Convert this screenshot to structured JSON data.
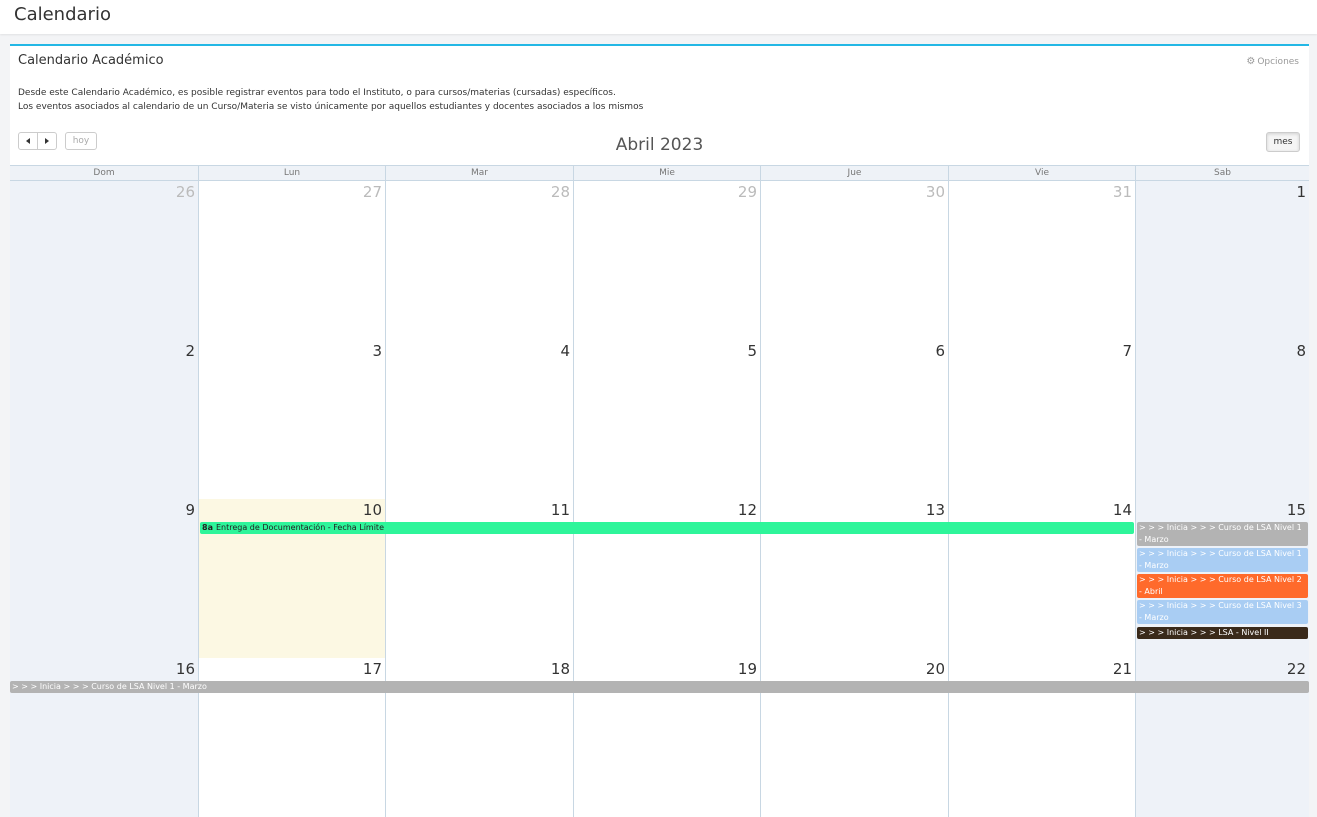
{
  "header": {
    "title": "Calendario"
  },
  "panel": {
    "title": "Calendario Académico",
    "options_label": "Opciones",
    "desc_line1": "Desde este Calendario Académico, es posible registrar eventos para todo el Instituto, o para cursos/materias (cursadas) específicos.",
    "desc_line2": "Los eventos asociados al calendario de un Curso/Materia se visto únicamente por aquellos estudiantes y docentes asociados a los mismos"
  },
  "toolbar": {
    "prev_icon": "triangle-left-icon",
    "next_icon": "triangle-right-icon",
    "today_label": "hoy",
    "month_button_label": "mes",
    "month_title": "Abril 2023"
  },
  "calendar": {
    "weekdays": [
      "Dom",
      "Lun",
      "Mar",
      "Mie",
      "Jue",
      "Vie",
      "Sab"
    ],
    "weeks": [
      [
        "26",
        "27",
        "28",
        "29",
        "30",
        "31",
        "1"
      ],
      [
        "2",
        "3",
        "4",
        "5",
        "6",
        "7",
        "8"
      ],
      [
        "9",
        "10",
        "11",
        "12",
        "13",
        "14",
        "15"
      ],
      [
        "16",
        "17",
        "18",
        "19",
        "20",
        "21",
        "22"
      ]
    ],
    "events": {
      "deadline": {
        "time": "8a",
        "title": "Entrega de Documentación - Fecha Límite",
        "color": "#2ef59a",
        "text_color": "#222222"
      },
      "sat15": [
        {
          "title": "> > > Inicia > > > Curso de LSA Nivel 1 - Marzo",
          "color": "#b3b3b3"
        },
        {
          "title": "> > > Inicia > > > Curso de LSA Nivel 1 - Marzo",
          "color": "#a9cdf3"
        },
        {
          "title": "> > > Inicia > > > Curso de LSA Nivel 2 - Abril",
          "color": "#ff6a2b"
        },
        {
          "title": "> > > Inicia > > > Curso de LSA Nivel 3 - Marzo",
          "color": "#a9cdf3"
        },
        {
          "title": "> > > Inicia > > > LSA - Nivel II",
          "color": "#3a2a1a"
        }
      ],
      "week4": {
        "title": "> > > Inicia > > > Curso de LSA Nivel 1 - Marzo",
        "color": "#b3b3b3"
      }
    }
  },
  "colors": {
    "accent": "#23b7e5",
    "weekend_bg": "#eef2f8",
    "today_bg": "#fcf8e3",
    "grid_line": "#c8d7e3"
  }
}
